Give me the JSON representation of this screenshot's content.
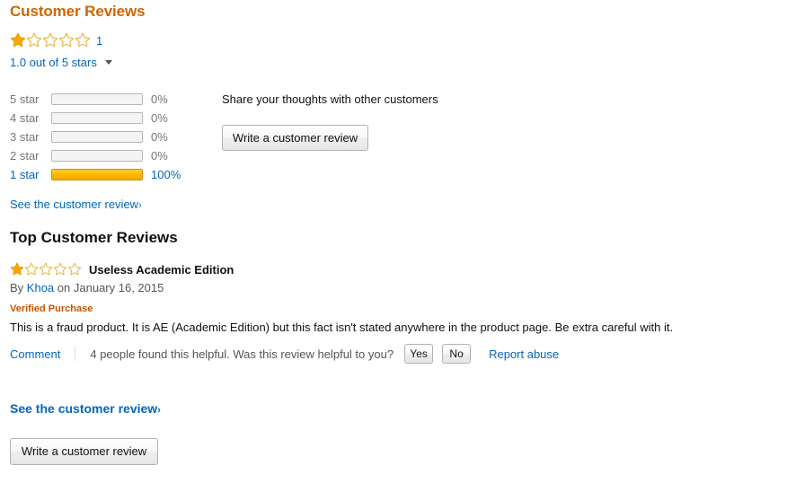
{
  "header": {
    "title": "Customer Reviews",
    "review_count": "1",
    "rating_value": 1.0,
    "rating_text": "1.0 out of 5 stars",
    "stars_filled": 1,
    "stars_total": 5,
    "caret_icon": "chevron-down-icon"
  },
  "histogram": {
    "rows": [
      {
        "label": "5 star",
        "percent_label": "0%",
        "percent": 0
      },
      {
        "label": "4 star",
        "percent_label": "0%",
        "percent": 0
      },
      {
        "label": "3 star",
        "percent_label": "0%",
        "percent": 0
      },
      {
        "label": "2 star",
        "percent_label": "0%",
        "percent": 0
      },
      {
        "label": "1 star",
        "percent_label": "100%",
        "percent": 100
      }
    ]
  },
  "see_review_top": {
    "label": "See the customer review",
    "caret": "›"
  },
  "share": {
    "prompt": "Share your thoughts with other customers",
    "write_button_label": "Write a customer review"
  },
  "top_reviews": {
    "section_title": "Top Customer Reviews",
    "review": {
      "stars_filled": 1,
      "stars_total": 5,
      "title": "Useless Academic Edition",
      "byline_prefix": "By",
      "author": "Khoa",
      "byline_middle": "on",
      "date": "January 16, 2015",
      "verified_purchase": "Verified Purchase",
      "body": "This is a fraud product. It is AE (Academic Edition) but this fact isn't stated anywhere in the product page. Be extra careful with it.",
      "comment_label": "Comment",
      "helpful_text": "4 people found this helpful. Was this review helpful to you?",
      "helpful_count": 4,
      "yes_label": "Yes",
      "no_label": "No",
      "report_abuse_label": "Report abuse"
    }
  },
  "footer": {
    "see_review_label": "See the customer review",
    "see_review_caret": "›",
    "write_button_label": "Write a customer review"
  },
  "colors": {
    "brand_orange": "#cc6600",
    "link_blue": "#0066c0",
    "star_gold": "#ffa700",
    "verified_orange": "#c45500",
    "muted_gray": "#767676"
  }
}
